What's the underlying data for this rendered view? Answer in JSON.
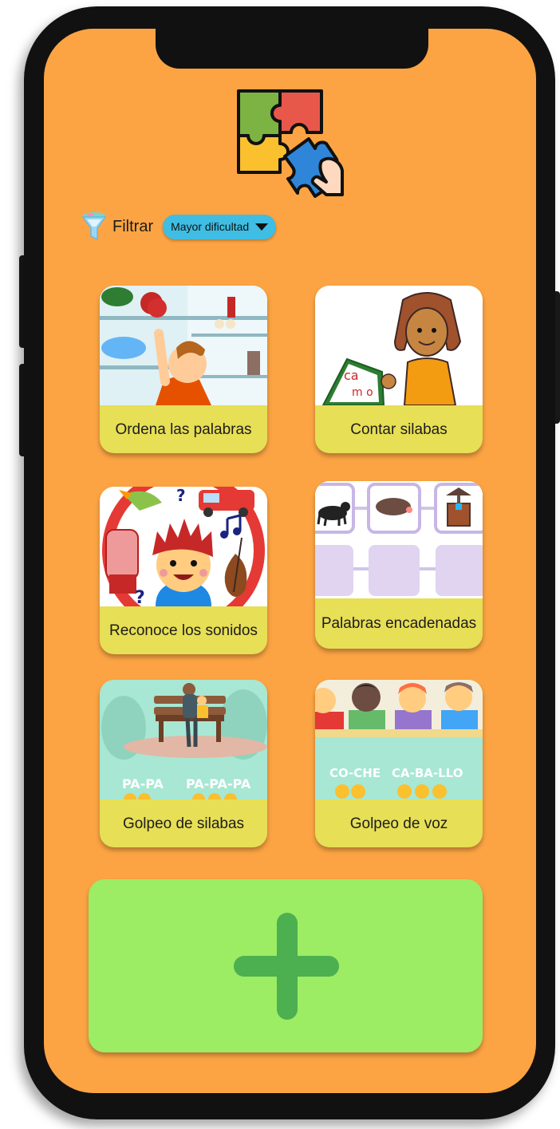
{
  "filter": {
    "icon": "funnel-icon",
    "label": "Filtrar",
    "dropdown_value": "Mayor dificultad"
  },
  "activities": [
    {
      "label": "Ordena las palabras",
      "icon": "boy-fridge-image"
    },
    {
      "label": "Contar silabas",
      "icon": "girl-blocks-image"
    },
    {
      "label": "Reconoce los sonidos",
      "icon": "boy-sounds-image"
    },
    {
      "label": "Palabras encadenadas",
      "icon": "chained-words-image"
    },
    {
      "label": "Golpeo de silabas",
      "icon": "syllable-clap-image",
      "image_text": [
        "PA-PA",
        "PA-PA-PA"
      ]
    },
    {
      "label": "Golpeo de voz",
      "icon": "voice-clap-image",
      "image_text": [
        "CO-CHE",
        "CA-BA-LLO"
      ]
    }
  ],
  "add_button": {
    "icon": "plus-icon"
  },
  "colors": {
    "screen": "#fca443",
    "card": "#e7df55",
    "dropdown": "#3fbde3",
    "add_card": "#9cec64",
    "plus": "#4caf50"
  }
}
